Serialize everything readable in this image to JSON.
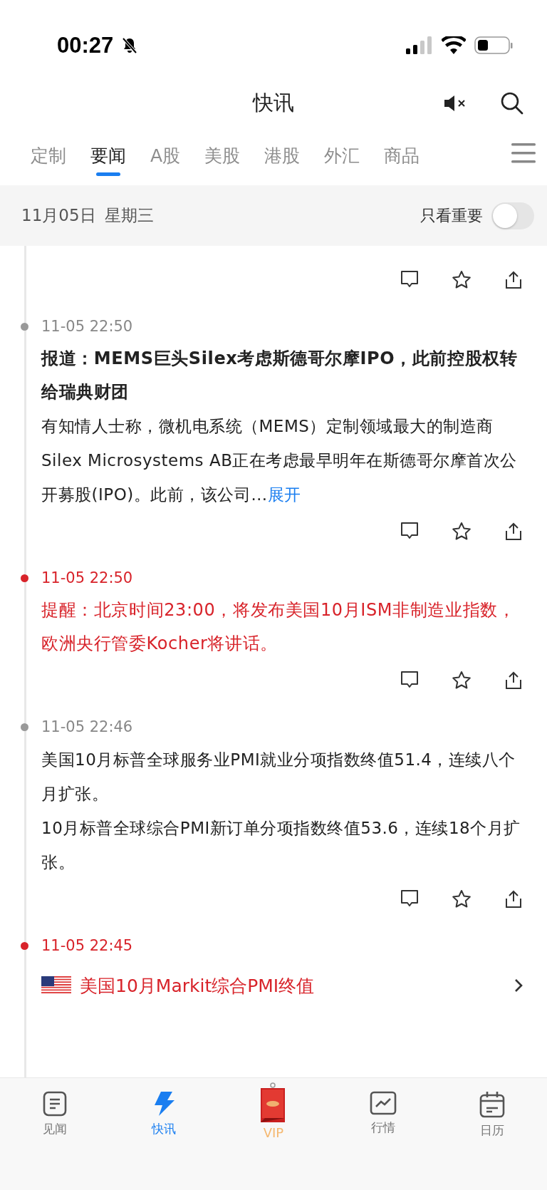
{
  "status_bar": {
    "time": "00:27",
    "silent": true
  },
  "header": {
    "title": "快讯"
  },
  "tabs": [
    {
      "label": "定制",
      "selected": false
    },
    {
      "label": "要闻",
      "selected": true
    },
    {
      "label": "A股",
      "selected": false
    },
    {
      "label": "美股",
      "selected": false
    },
    {
      "label": "港股",
      "selected": false
    },
    {
      "label": "外汇",
      "selected": false
    },
    {
      "label": "商品",
      "selected": false
    }
  ],
  "date_bar": {
    "date": "11月05日",
    "weekday": "星期三",
    "filter_label": "只看重要",
    "filter_on": false
  },
  "feed": [
    {
      "kind": "tail"
    },
    {
      "kind": "news",
      "important": false,
      "time": "11-05 22:50",
      "title": "报道：MEMS巨头Silex考虑斯德哥尔摩IPO，此前控股权转给瑞典财团",
      "body": "有知情人士称，微机电系统（MEMS）定制领域最大的制造商Silex Microsystems AB正在考虑最早明年在斯德哥尔摩首次公开募股(IPO)。此前，该公司…",
      "expand": "展开"
    },
    {
      "kind": "news",
      "important": true,
      "time": "11-05 22:50",
      "title": "提醒：北京时间23:00，将发布美国10月ISM非制造业指数，欧洲央行管委Kocher将讲话。"
    },
    {
      "kind": "news",
      "important": false,
      "time": "11-05 22:46",
      "paragraphs": [
        "美国10月标普全球服务业PMI就业分项指数终值51.4，连续八个月扩张。",
        "10月标普全球综合PMI新订单分项指数终值53.6，连续18个月扩张。"
      ]
    },
    {
      "kind": "indicator",
      "important": true,
      "time": "11-05 22:45",
      "title": "美国10月Markit综合PMI终值"
    }
  ],
  "bottom_nav": [
    {
      "label": "见闻",
      "kind": "doc",
      "selected": false
    },
    {
      "label": "快讯",
      "kind": "bolt",
      "selected": true
    },
    {
      "label": "VIP",
      "kind": "vip",
      "selected": false
    },
    {
      "label": "行情",
      "kind": "chart",
      "selected": false
    },
    {
      "label": "日历",
      "kind": "calendar",
      "selected": false
    }
  ]
}
